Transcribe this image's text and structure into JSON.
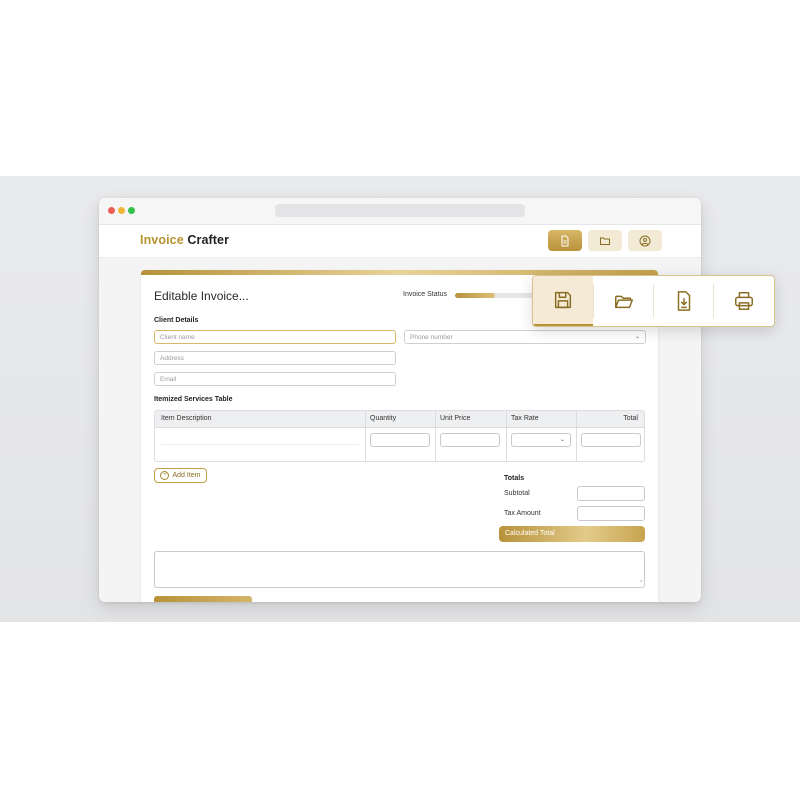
{
  "app": {
    "title_part1": "Invoice",
    "title_part2": "Crafter",
    "accent_color": "#b8932f"
  },
  "nav": {
    "items": [
      {
        "icon": "document-icon",
        "active": true
      },
      {
        "icon": "folder-icon",
        "active": false
      },
      {
        "icon": "user-icon",
        "active": false
      }
    ]
  },
  "invoice": {
    "title": "Editable Invoice...",
    "status_label": "Invoice Status",
    "status_progress": 0.5
  },
  "client": {
    "section_label": "Client Details",
    "name_placeholder": "Client name",
    "phone_placeholder": "Phone number",
    "address_placeholder": "Address",
    "email_placeholder": "Email"
  },
  "services": {
    "section_label": "Itemized Services Table",
    "columns": [
      "Item Description",
      "Quantity",
      "Unit Price",
      "Tax Rate",
      "Total"
    ],
    "add_item_label": "Add Item"
  },
  "totals": {
    "heading": "Totals",
    "subtotal_label": "Subtotal",
    "tax_label": "Tax Amount",
    "calculated_label": "Calculated Total"
  },
  "toolbar": {
    "items": [
      {
        "icon": "save-icon",
        "active": true
      },
      {
        "icon": "folder-open-icon",
        "active": false
      },
      {
        "icon": "download-icon",
        "active": false
      },
      {
        "icon": "print-icon",
        "active": false
      }
    ]
  }
}
